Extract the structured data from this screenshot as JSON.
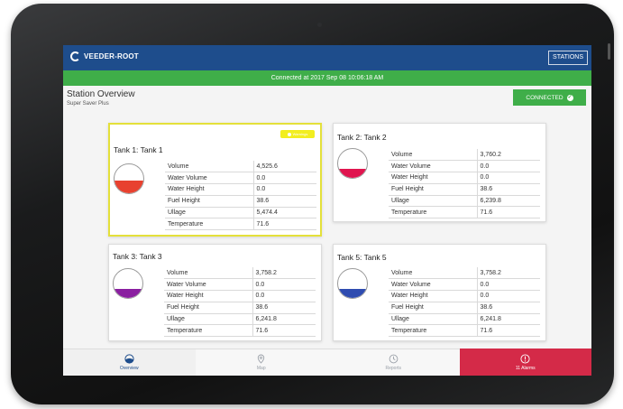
{
  "app": {
    "brand": "VEEDER-ROOT",
    "stations_label": "STATIONS",
    "status_text": "Connected at 2017 Sep 08 10:06:18 AM"
  },
  "overview": {
    "title": "Station Overview",
    "subtitle": "Super Saver Plus",
    "connected_label": "CONNECTED"
  },
  "row_labels": [
    "Volume",
    "Water Volume",
    "Water Height",
    "Fuel Height",
    "Ullage",
    "Temperature"
  ],
  "tanks": [
    {
      "title": "Tank 1: Tank 1",
      "badge": "Warnings",
      "fill_color": "#e8412f",
      "fill_level": 0.45,
      "values": [
        "4,525.6",
        "0.0",
        "0.0",
        "38.6",
        "5,474.4",
        "71.6"
      ]
    },
    {
      "title": "Tank 2: Tank 2",
      "fill_color": "#e0154f",
      "fill_level": 0.32,
      "values": [
        "3,760.2",
        "0.0",
        "0.0",
        "38.6",
        "6,239.8",
        "71.6"
      ]
    },
    {
      "title": "Tank 3: Tank 3",
      "fill_color": "#8a1fa0",
      "fill_level": 0.32,
      "values": [
        "3,758.2",
        "0.0",
        "0.0",
        "38.6",
        "6,241.8",
        "71.6"
      ]
    },
    {
      "title": "Tank 5: Tank 5",
      "fill_color": "#2f4cb0",
      "fill_level": 0.32,
      "values": [
        "3,758.2",
        "0.0",
        "0.0",
        "38.6",
        "6,241.8",
        "71.6"
      ]
    }
  ],
  "nav": {
    "overview": "Overview",
    "map": "Map",
    "reports": "Reports",
    "alarms": "11 Alarms"
  },
  "colors": {
    "brand_blue": "#1e4d8c",
    "connected_green": "#3fae49",
    "alarm_red": "#d42a48",
    "warning_yellow": "#f2ee1f"
  }
}
